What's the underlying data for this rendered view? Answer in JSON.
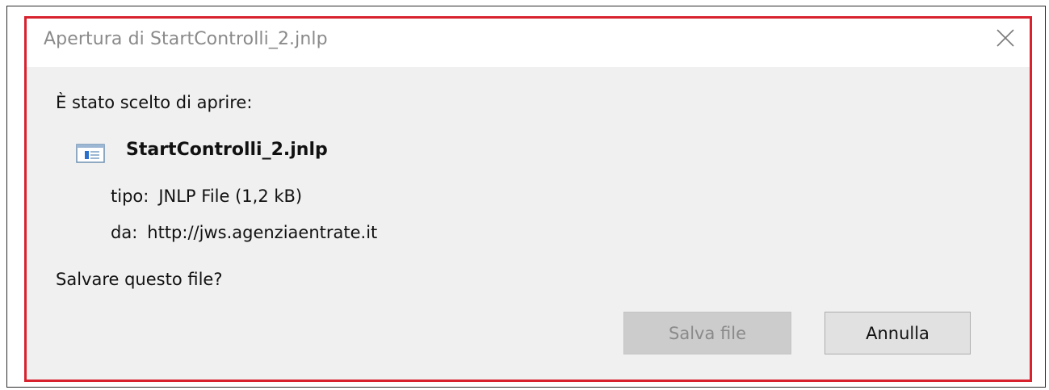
{
  "dialog": {
    "title": "Apertura di StartControlli_2.jnlp",
    "close_icon": "close-x-icon",
    "intro": "È stato scelto di aprire:",
    "file": {
      "icon": "jnlp-file-icon",
      "name": "StartControlli_2.jnlp",
      "type_label": "tipo:",
      "type_value": "JNLP File (1,2 kB)",
      "from_label": "da:",
      "from_value": "http://jws.agenziaentrate.it"
    },
    "question": "Salvare questo file?",
    "buttons": {
      "save": "Salva file",
      "cancel": "Annulla"
    }
  },
  "colors": {
    "highlight_border": "#d8232f",
    "dialog_background": "#f0f0f0",
    "title_text": "#8a8a8a",
    "disabled_button_background": "#cccccc",
    "button_background": "#e1e1e1"
  }
}
